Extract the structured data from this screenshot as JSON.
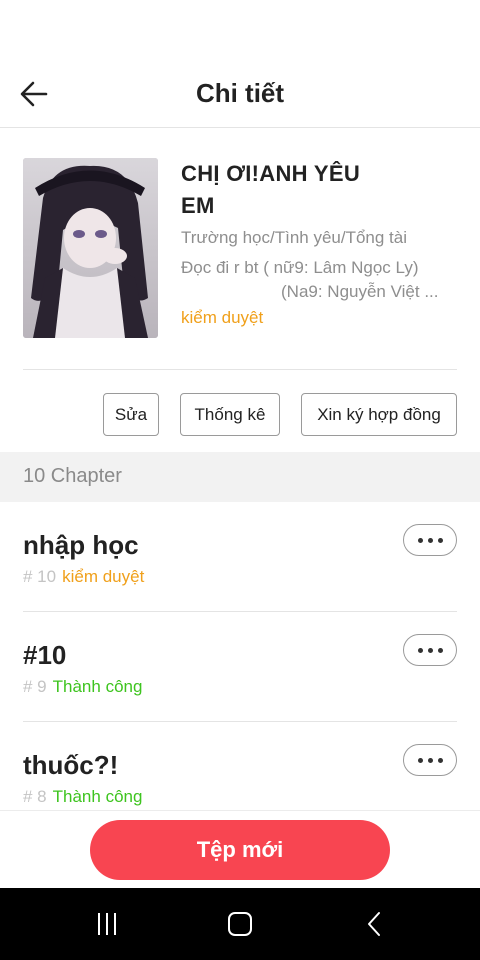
{
  "header": {
    "title": "Chi tiết",
    "back_icon": "arrow-left-icon"
  },
  "story": {
    "title": "CHỊ ƠI!ANH YÊU EM",
    "genres": "Trường học/Tình yêu/Tổng tài",
    "description_line1": "Đọc đi r bt ( nữ9: Lâm Ngọc Ly)",
    "description_line2": "(Na9: Nguyễn Việt ...",
    "status": "kiểm duyệt",
    "status_color": "#f0a01b"
  },
  "actions": {
    "edit_label": "Sửa",
    "stats_label": "Thống kê",
    "contract_label": "Xin ký hợp đồng"
  },
  "chapters_header": "10 Chapter",
  "chapters": [
    {
      "title": "nhập học",
      "number": "# 10",
      "status": "kiểm duyệt"
    },
    {
      "title": "#10",
      "number": "# 9",
      "status": "Thành công"
    },
    {
      "title": "thuốc?!",
      "number": "# 8",
      "status": "Thành công"
    }
  ],
  "bottom": {
    "new_button_label": "Tệp mới",
    "accent_color": "#f84551"
  },
  "system_nav": {
    "recent_icon": "recent-apps-icon",
    "home_icon": "home-icon",
    "back_icon": "back-chevron-icon"
  }
}
